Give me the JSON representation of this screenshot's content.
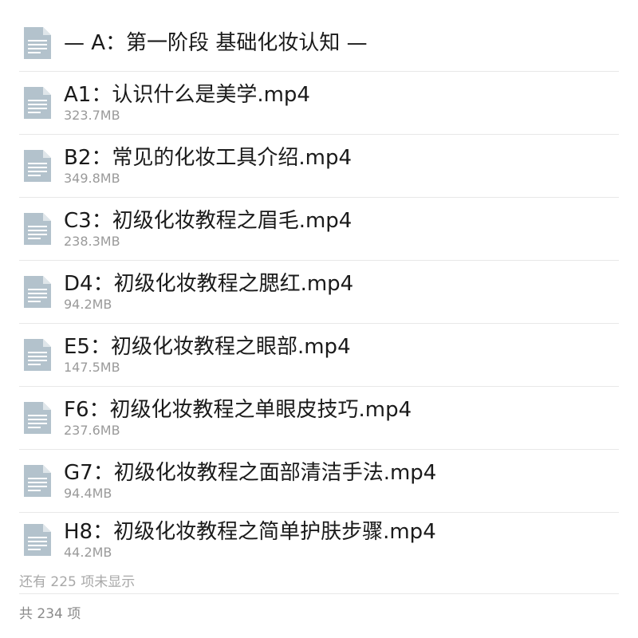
{
  "section": {
    "title": "— A：第一阶段 基础化妆认知 —",
    "icon": "document-icon"
  },
  "files": [
    {
      "name": "A1：认识什么是美学.mp4",
      "size": "323.7MB",
      "icon": "document-icon"
    },
    {
      "name": "B2：常见的化妆工具介绍.mp4",
      "size": "349.8MB",
      "icon": "document-icon"
    },
    {
      "name": "C3：初级化妆教程之眉毛.mp4",
      "size": "238.3MB",
      "icon": "document-icon"
    },
    {
      "name": "D4：初级化妆教程之腮红.mp4",
      "size": "94.2MB",
      "icon": "document-icon"
    },
    {
      "name": "E5：初级化妆教程之眼部.mp4",
      "size": "147.5MB",
      "icon": "document-icon"
    },
    {
      "name": "F6：初级化妆教程之单眼皮技巧.mp4",
      "size": "237.6MB",
      "icon": "document-icon"
    },
    {
      "name": "G7：初级化妆教程之面部清洁手法.mp4",
      "size": "94.4MB",
      "icon": "document-icon"
    },
    {
      "name": "H8：初级化妆教程之简单护肤步骤.mp4",
      "size": "44.2MB",
      "icon": "document-icon"
    }
  ],
  "footer": {
    "more_note": "还有 225 项未显示",
    "total": "共 234 项"
  },
  "colors": {
    "icon_fill": "#b3c2cc",
    "icon_lines": "#ffffff",
    "icon_fold": "#dfe6ea",
    "divider": "#e8e8e8",
    "secondary_text": "#9a9a9a"
  }
}
